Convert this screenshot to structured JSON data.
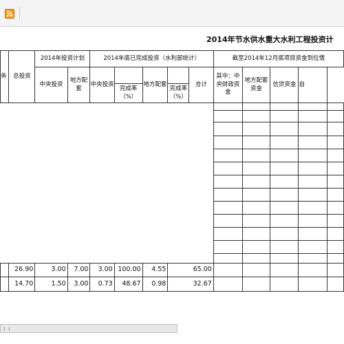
{
  "title": "2014年节水供水重大水利工程投资计",
  "header": {
    "task": "务",
    "total_investment": "总投资",
    "plan_2014": "2014年投资计划",
    "completed_2014": "2014年底已完成投资（水利部统计）",
    "funds_2014": "截至2014年12月底项目资金到位情",
    "central_investment": "中央投资",
    "local_matching": "地方配套",
    "completion_rate": "完成率（%）",
    "total": "合计",
    "central_fiscal": "其中：中央财政资金",
    "local_matching_funds": "地方配套资金",
    "credit_funds": "信贷资金",
    "self_cut": "自"
  },
  "rows": [
    {
      "total_investment": "26.90",
      "plan_central": "3.00",
      "plan_local": "7.00",
      "done_central": "3.00",
      "done_central_rate": "100.00",
      "done_local": "4.55",
      "done_local_rate": "65.00"
    },
    {
      "total_investment": "14.70",
      "plan_central": "1.50",
      "plan_local": "3.00",
      "done_central": "0.73",
      "done_central_rate": "48.67",
      "done_local": "0.98",
      "done_local_rate": "32.67"
    }
  ],
  "icons": {
    "feed": "rss-feed-icon"
  }
}
